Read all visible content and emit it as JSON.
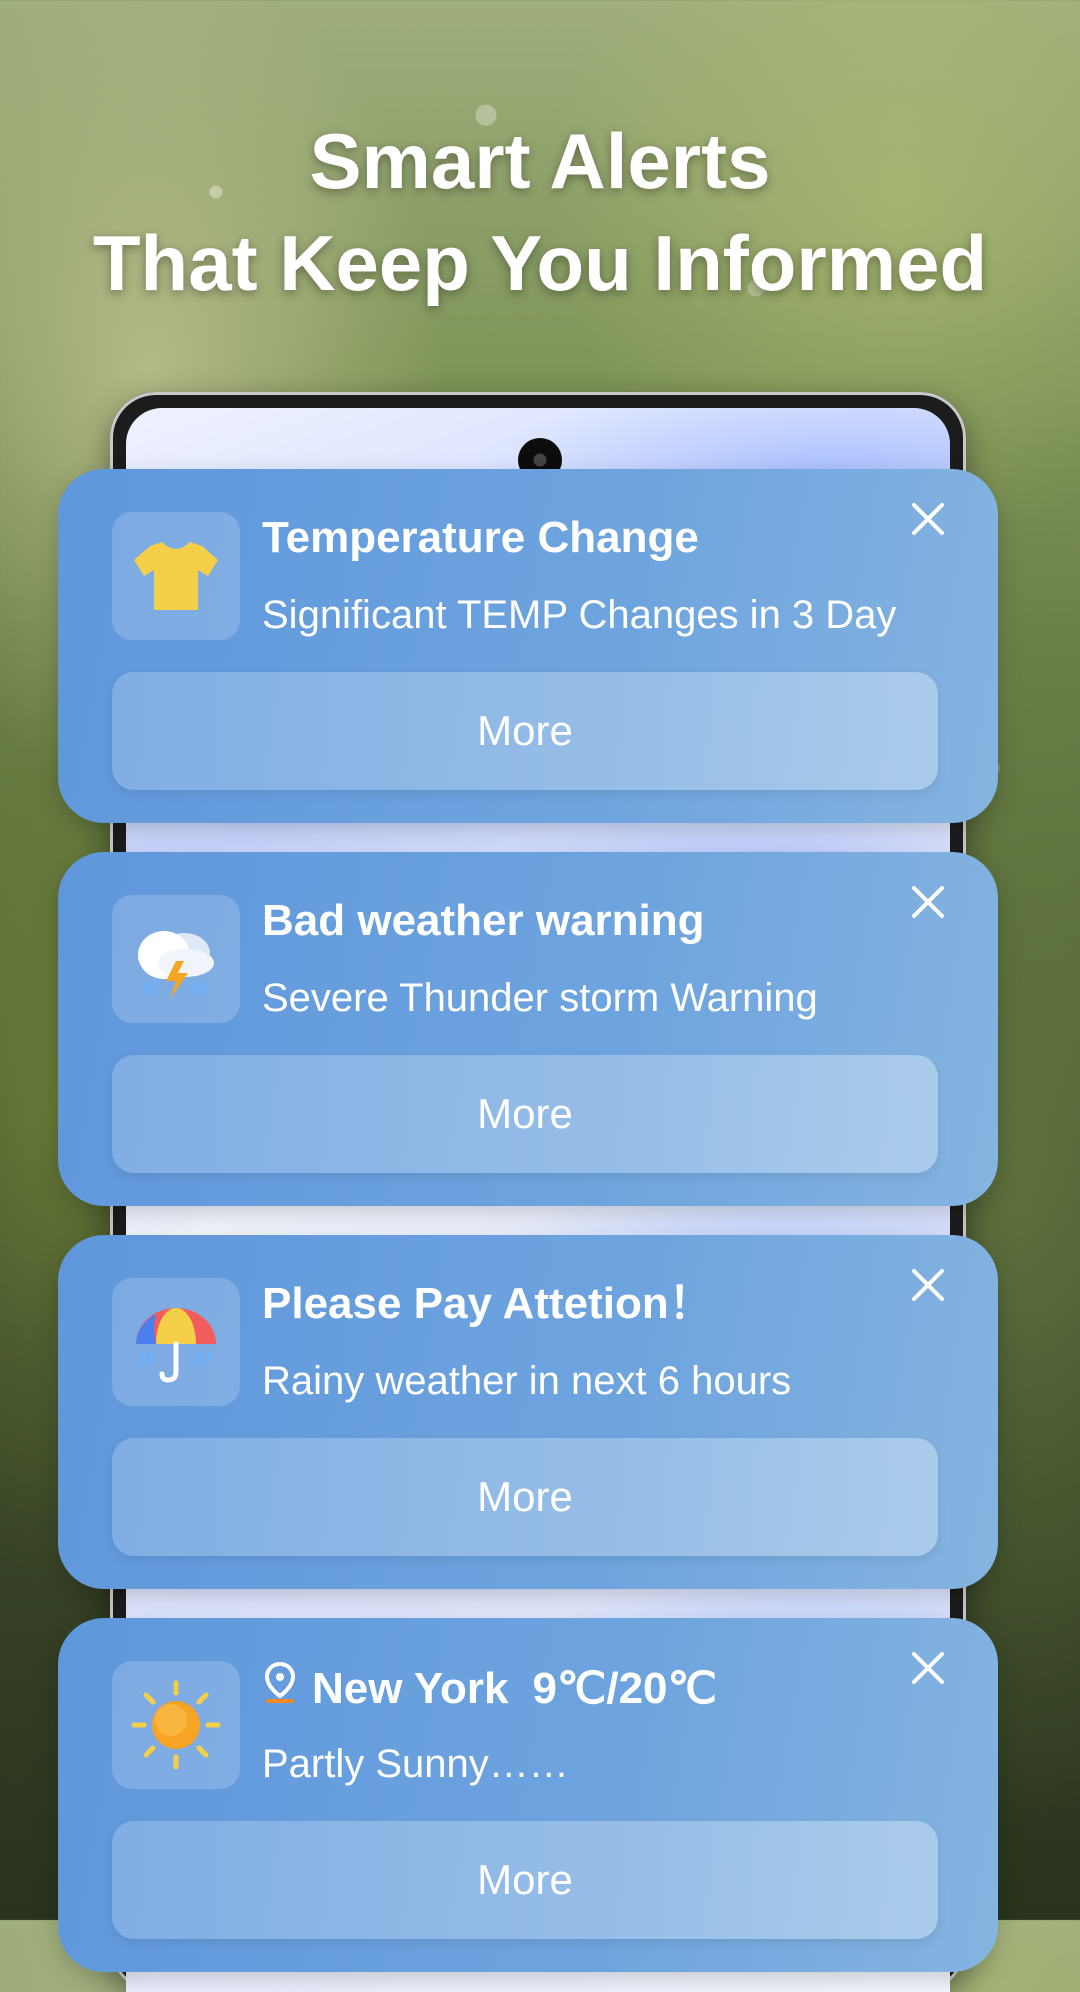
{
  "headline": {
    "line1": "Smart Alerts",
    "line2": "That Keep You Informed"
  },
  "cards": [
    {
      "icon": "t-shirt-icon",
      "title": "Temperature Change",
      "subtitle": "Significant TEMP Changes in 3 Day",
      "button": "More"
    },
    {
      "icon": "thunderstorm-icon",
      "title": "Bad weather warning",
      "subtitle": "Severe Thunder storm Warning",
      "button": "More"
    },
    {
      "icon": "umbrella-rain-icon",
      "title": "Please Pay Attetion！",
      "subtitle": "Rainy weather in next 6 hours",
      "button": "More"
    },
    {
      "icon": "sun-icon",
      "location": "New York",
      "temperature": "9℃/20℃",
      "subtitle": "Partly Sunny……",
      "button": "More"
    }
  ],
  "colors": {
    "card_bg": "#6ea4de",
    "tshirt": "#f5cf47",
    "sun": "#f7a425",
    "pin": "#f08a24"
  }
}
